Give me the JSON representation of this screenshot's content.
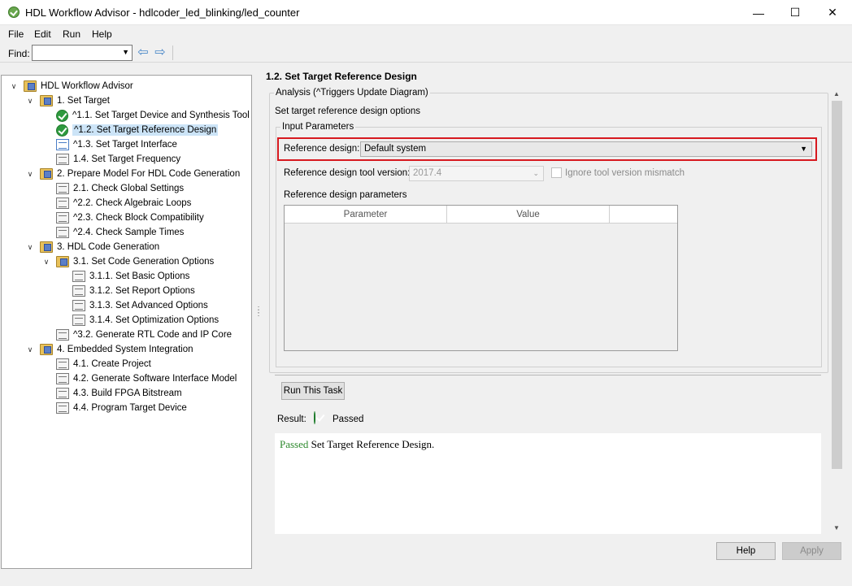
{
  "window": {
    "title": "HDL Workflow Advisor - hdlcoder_led_blinking/led_counter",
    "minimize": "—",
    "maximize": "☐",
    "close": "✕"
  },
  "menu": [
    "File",
    "Edit",
    "Run",
    "Help"
  ],
  "toolbar": {
    "find_label": "Find:",
    "find_value": "",
    "back_glyph": "⇦",
    "forward_glyph": "⇨"
  },
  "tree": [
    {
      "label": "HDL Workflow Advisor",
      "icon": "folder-icon",
      "expanded": true
    },
    {
      "label": "1. Set Target",
      "icon": "folder-icon",
      "expanded": true
    },
    {
      "label": "^1.1. Set Target Device and Synthesis Tool",
      "icon": "check-icon"
    },
    {
      "label": "^1.2. Set Target Reference Design",
      "icon": "check-icon",
      "selected": true
    },
    {
      "label": "^1.3. Set Target Interface",
      "icon": "task-icon-blue"
    },
    {
      "label": "1.4. Set Target Frequency",
      "icon": "task-icon"
    },
    {
      "label": "2. Prepare Model For HDL Code Generation",
      "icon": "folder-icon",
      "expanded": true
    },
    {
      "label": "2.1. Check Global Settings",
      "icon": "task-icon"
    },
    {
      "label": "^2.2. Check Algebraic Loops",
      "icon": "task-icon"
    },
    {
      "label": "^2.3. Check Block Compatibility",
      "icon": "task-icon"
    },
    {
      "label": "^2.4. Check Sample Times",
      "icon": "task-icon"
    },
    {
      "label": "3. HDL Code Generation",
      "icon": "folder-icon",
      "expanded": true
    },
    {
      "label": "3.1. Set Code Generation Options",
      "icon": "folder-icon",
      "expanded": true
    },
    {
      "label": "3.1.1. Set Basic Options",
      "icon": "task-icon"
    },
    {
      "label": "3.1.2. Set Report Options",
      "icon": "task-icon"
    },
    {
      "label": "3.1.3. Set Advanced Options",
      "icon": "task-icon"
    },
    {
      "label": "3.1.4. Set Optimization Options",
      "icon": "task-icon"
    },
    {
      "label": "^3.2. Generate RTL Code and IP Core",
      "icon": "task-icon"
    },
    {
      "label": "4. Embedded System Integration",
      "icon": "folder-icon",
      "expanded": true
    },
    {
      "label": "4.1. Create Project",
      "icon": "task-icon"
    },
    {
      "label": "4.2. Generate Software Interface Model",
      "icon": "task-icon"
    },
    {
      "label": "4.3. Build FPGA Bitstream",
      "icon": "task-icon"
    },
    {
      "label": "4.4. Program Target Device",
      "icon": "task-icon"
    }
  ],
  "panel": {
    "title": "1.2. Set Target Reference Design",
    "analysis_legend": "Analysis (^Triggers Update Diagram)",
    "analysis_desc": "Set target reference design options",
    "input_legend": "Input Parameters",
    "ref_design_label": "Reference design:",
    "ref_design_value": "Default system",
    "tool_version_label": "Reference design tool version:",
    "tool_version_value": "2017.4",
    "ignore_label": "Ignore tool version mismatch",
    "params_label": "Reference design parameters",
    "params_columns": [
      "Parameter",
      "Value",
      ""
    ],
    "run_task": "Run This Task",
    "result_label": "Result:",
    "result_status": "Passed",
    "result_msg_status": "Passed",
    "result_msg_text": " Set Target Reference Design."
  },
  "buttons": {
    "help": "Help",
    "apply": "Apply"
  },
  "colors": {
    "highlight": "#d7191f",
    "pass_green": "#2e9a3e",
    "selection": "#cce4f7"
  }
}
